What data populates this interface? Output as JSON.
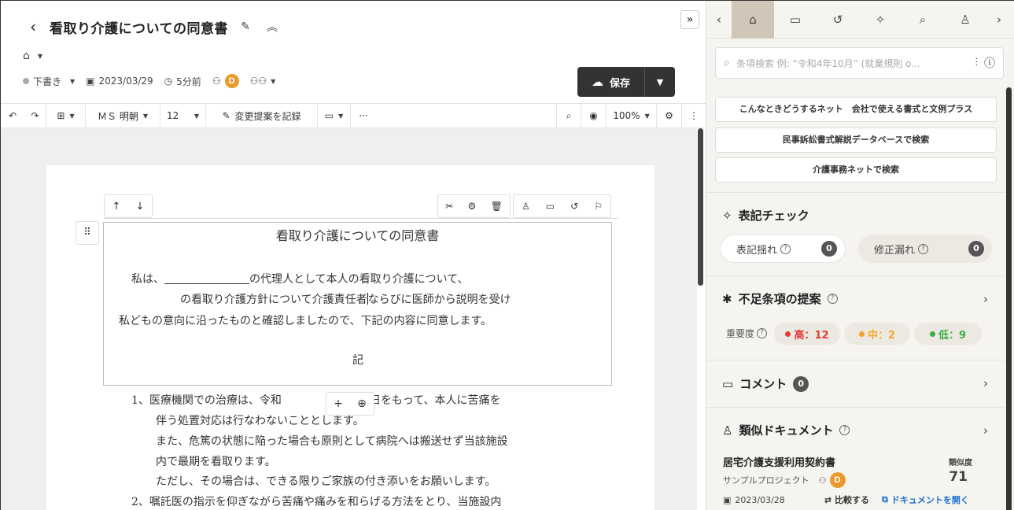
{
  "header": {
    "title": "看取り介護についての同意書",
    "collapse_label": "»"
  },
  "meta": {
    "status": "下書き",
    "date": "2023/03/29",
    "updated": "5分前",
    "owner_initial": "D"
  },
  "save": {
    "label": "保存"
  },
  "toolbar": {
    "font": "ＭＳ 明朝",
    "size": "12",
    "track_changes": "変更提案を記録",
    "zoom": "100%"
  },
  "document": {
    "heading": "看取り介護についての同意書",
    "line1_a": "私は、",
    "line1_b": "の代理人として本人の看取り介護について、",
    "line2_a": "の看取り介護方針について介護責任者",
    "line2_b": "ならびに医師から説明を受け",
    "line3": "私どもの意向に沿ったものと確認しましたので、下記の内容に同意します。",
    "ki": "記",
    "item1_a": "1、医療機関での治療は、令和",
    "item1_b": "日をもって、本人に苦痛を",
    "item1_c": "伴う処置対応は行なわないこととします。",
    "item1_d": "また、危篤の状態に陥った場合も原則として病院へは搬送せず当該施設",
    "item1_e": "内で最期を看取ります。",
    "item1_f": "ただし、その場合は、できる限りご家族の付き添いをお願いします。",
    "item2": "2、嘱託医の指示を仰ぎながら苦痛や痛みを和らげる方法をとり、当施設内"
  },
  "sidebar": {
    "search_placeholder": "条項検索 例: “令和4年10月” (就業規則 o...",
    "links": [
      "こんなときどうするネット　会社で使える書式と文例プラス",
      "民事訴訟書式解説データベースで検索",
      "介護事務ネットで検索"
    ],
    "notation": {
      "title": "表記チェック",
      "inconsistency_label": "表記揺れ",
      "inconsistency_count": "0",
      "missed_label": "修正漏れ",
      "missed_count": "0"
    },
    "missing_clauses": {
      "title": "不足条項の提案",
      "importance_label": "重要度",
      "high": "高：12",
      "mid": "中：2",
      "low": "低：9"
    },
    "comments": {
      "title": "コメント",
      "count": "0"
    },
    "similar": {
      "title": "類似ドキュメント",
      "doc_title": "居宅介護支援利用契約書",
      "project": "サンプルプロジェクト",
      "owner_initial": "D",
      "score_label": "類似度",
      "score": "71",
      "date": "2023/03/28",
      "compare": "比較する",
      "open": "ドキュメントを開く"
    }
  },
  "colors": {
    "accent_dark": "#333333",
    "active_tab": "#cfc6b8",
    "avatar": "#e99a2c",
    "high": "#e53935",
    "mid": "#f5a623",
    "low": "#3cb043",
    "link_blue": "#1a6fd1"
  }
}
